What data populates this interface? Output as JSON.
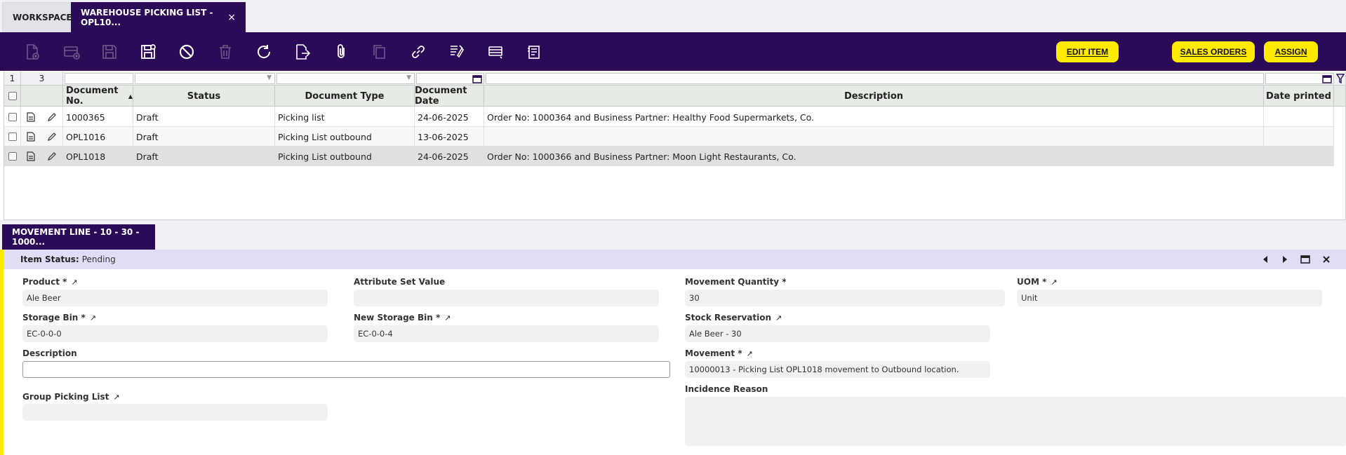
{
  "tabs": {
    "workspace": "WORKSPACE",
    "active": "WAREHOUSE PICKING LIST - OPL10...",
    "close": "×"
  },
  "toolbar": {
    "icons": [
      "new-document-icon",
      "new-row-icon",
      "save-icon",
      "save-close-icon",
      "undo-icon",
      "delete-icon",
      "refresh-icon",
      "export-icon",
      "attach-icon",
      "copy-icon",
      "link-icon",
      "audit-icon",
      "print-icon",
      "notes-icon"
    ],
    "buttons": {
      "edit_item": "EDIT ITEM",
      "sales_orders": "SALES ORDERS",
      "assign": "ASSIGN"
    }
  },
  "grid": {
    "selected_count": "1",
    "total_count": "3",
    "columns": [
      "Document No.",
      "Status",
      "Document Type",
      "Document Date",
      "Description",
      "Date printed"
    ],
    "sort_indicator": "▲",
    "rows": [
      {
        "doc_no": "1000365",
        "status": "Draft",
        "doc_type": "Picking list",
        "doc_date": "24-06-2025",
        "description": "Order No: 1000364 and Business Partner: Healthy Food Supermarkets, Co.",
        "date_printed": ""
      },
      {
        "doc_no": "OPL1016",
        "status": "Draft",
        "doc_type": "Picking List outbound",
        "doc_date": "13-06-2025",
        "description": "",
        "date_printed": ""
      },
      {
        "doc_no": "OPL1018",
        "status": "Draft",
        "doc_type": "Picking List outbound",
        "doc_date": "24-06-2025",
        "description": "Order No: 1000366 and Business Partner: Moon Light Restaurants, Co.",
        "date_printed": ""
      }
    ]
  },
  "lower_tab": {
    "label": "MOVEMENT LINE - 10 - 30 - 1000..."
  },
  "form": {
    "status_label": "Item Status:",
    "status_value": "Pending",
    "product": {
      "label": "Product *",
      "value": "Ale Beer"
    },
    "attribute_set_value": {
      "label": "Attribute Set Value",
      "value": ""
    },
    "movement_quantity": {
      "label": "Movement Quantity *",
      "value": "30"
    },
    "uom": {
      "label": "UOM *",
      "value": "Unit"
    },
    "storage_bin": {
      "label": "Storage Bin *",
      "value": "EC-0-0-0"
    },
    "new_storage_bin": {
      "label": "New Storage Bin *",
      "value": "EC-0-0-4"
    },
    "stock_reservation": {
      "label": "Stock Reservation",
      "value": "Ale Beer - 30"
    },
    "description": {
      "label": "Description",
      "value": ""
    },
    "movement": {
      "label": "Movement *",
      "value": "10000013 - Picking List OPL1018 movement to Outbound location."
    },
    "group_picking_list": {
      "label": "Group Picking List",
      "value": ""
    },
    "incidence_reason": {
      "label": "Incidence Reason",
      "value": ""
    }
  },
  "colors": {
    "brand": "#2b0a57",
    "accent": "#ffea00",
    "status_bar": "#e3dcf7"
  }
}
